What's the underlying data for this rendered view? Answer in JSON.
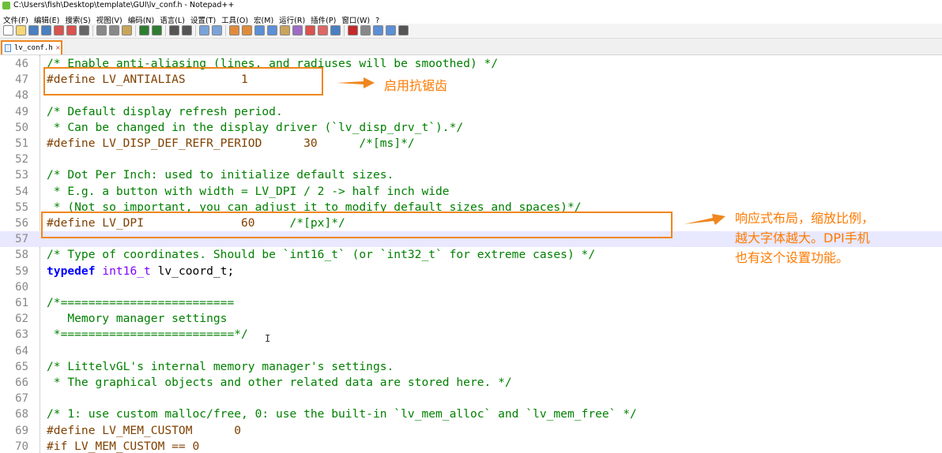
{
  "window": {
    "title": "C:\\Users\\fish\\Desktop\\template\\GUI\\lv_conf.h - Notepad++"
  },
  "menu": [
    "文件(F)",
    "编辑(E)",
    "搜索(S)",
    "视图(V)",
    "编码(N)",
    "语言(L)",
    "设置(T)",
    "工具(O)",
    "宏(M)",
    "运行(R)",
    "插件(P)",
    "窗口(W)",
    "?"
  ],
  "toolbar": {
    "icons": [
      "new-file-icon",
      "open-file-icon",
      "save-icon",
      "save-all-icon",
      "close-icon",
      "close-all-icon",
      "print-icon",
      "cut-icon",
      "copy-icon",
      "paste-icon",
      "undo-icon",
      "redo-icon",
      "find-icon",
      "replace-icon",
      "zoom-in-icon",
      "zoom-out-icon",
      "sync-vertical-icon",
      "sync-horizontal-icon",
      "word-wrap-icon",
      "all-chars-icon",
      "indent-guide-icon",
      "udl-icon",
      "doc-map-icon",
      "function-list-icon",
      "monitor-icon",
      "record-macro-icon",
      "stop-macro-icon",
      "play-macro-icon",
      "run-macro-multiple-icon",
      "save-macro-icon"
    ]
  },
  "tab": {
    "label": "lv_conf.h",
    "close": "×"
  },
  "editor": {
    "lines": [
      {
        "n": "46",
        "tokens": [
          {
            "t": "/* Enable anti-aliasing (lines, and radiuses will be smoothed) */",
            "c": "comment"
          }
        ]
      },
      {
        "n": "47",
        "tokens": [
          {
            "t": "#define LV_ANTIALIAS        1",
            "c": "pre"
          }
        ]
      },
      {
        "n": "48",
        "tokens": []
      },
      {
        "n": "49",
        "tokens": [
          {
            "t": "/* Default display refresh period.",
            "c": "comment"
          }
        ]
      },
      {
        "n": "50",
        "tokens": [
          {
            "t": " * Can be changed in the display driver (`lv_disp_drv_t`).*/",
            "c": "comment"
          }
        ]
      },
      {
        "n": "51",
        "tokens": [
          {
            "t": "#define LV_DISP_DEF_REFR_PERIOD      30      ",
            "c": "pre"
          },
          {
            "t": "/*[ms]*/",
            "c": "comment"
          }
        ]
      },
      {
        "n": "52",
        "tokens": []
      },
      {
        "n": "53",
        "tokens": [
          {
            "t": "/* Dot Per Inch: used to initialize default sizes.",
            "c": "comment"
          }
        ]
      },
      {
        "n": "54",
        "tokens": [
          {
            "t": " * E.g. a button with width = LV_DPI / 2 -> half inch wide",
            "c": "comment"
          }
        ]
      },
      {
        "n": "55",
        "tokens": [
          {
            "t": " * (Not so important, you can adjust it to modify default sizes and spaces)*/",
            "c": "comment"
          }
        ]
      },
      {
        "n": "56",
        "tokens": [
          {
            "t": "#define LV_DPI              60     ",
            "c": "pre"
          },
          {
            "t": "/*[px]*/",
            "c": "comment"
          }
        ]
      },
      {
        "n": "57",
        "tokens": [],
        "current": true
      },
      {
        "n": "58",
        "tokens": [
          {
            "t": "/* Type of coordinates. Should be `int16_t` (or `int32_t` for extreme cases) */",
            "c": "comment"
          }
        ]
      },
      {
        "n": "59",
        "tokens": [
          {
            "t": "typedef",
            "c": "kw"
          },
          {
            "t": " ",
            "c": "plain"
          },
          {
            "t": "int16_t",
            "c": "type"
          },
          {
            "t": " lv_coord_t;",
            "c": "plain"
          }
        ]
      },
      {
        "n": "60",
        "tokens": []
      },
      {
        "n": "61",
        "tokens": [
          {
            "t": "/*=========================",
            "c": "comment"
          }
        ]
      },
      {
        "n": "62",
        "tokens": [
          {
            "t": "   Memory manager settings",
            "c": "comment"
          }
        ]
      },
      {
        "n": "63",
        "tokens": [
          {
            "t": " *=========================*/",
            "c": "comment"
          }
        ]
      },
      {
        "n": "64",
        "tokens": []
      },
      {
        "n": "65",
        "tokens": [
          {
            "t": "/* LittelvGL's internal memory manager's settings.",
            "c": "comment"
          }
        ]
      },
      {
        "n": "66",
        "tokens": [
          {
            "t": " * The graphical objects and other related data are stored here. */",
            "c": "comment"
          }
        ]
      },
      {
        "n": "67",
        "tokens": []
      },
      {
        "n": "68",
        "tokens": [
          {
            "t": "/* 1: use custom malloc/free, 0: use the built-in `lv_mem_alloc` and `lv_mem_free` */",
            "c": "comment"
          }
        ]
      },
      {
        "n": "69",
        "tokens": [
          {
            "t": "#define LV_MEM_CUSTOM      0",
            "c": "pre"
          }
        ]
      },
      {
        "n": "70",
        "tokens": [
          {
            "t": "#if LV_MEM_CUSTOM == 0",
            "c": "pre"
          }
        ]
      }
    ]
  },
  "annotations": {
    "antialias_note": "启用抗锯齿",
    "dpi_note_lines": [
      "响应式布局，缩放比例，",
      "越大字体越大。DPI手机",
      "也有这个设置功能。"
    ],
    "color": "#f0861d"
  },
  "colors": {
    "comment": "#008000",
    "preprocessor": "#804000",
    "keyword": "#0000ff",
    "type": "#8000ff",
    "current_line": "#e8e8ff",
    "highlight": "#f0861d"
  }
}
